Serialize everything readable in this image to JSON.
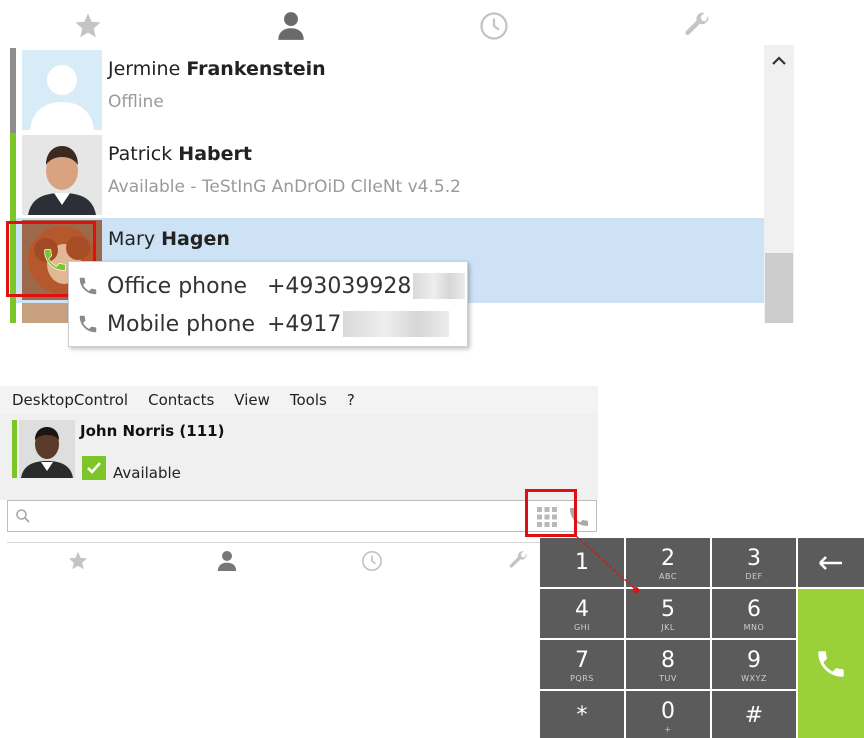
{
  "top_tabs": [
    {
      "icon": "star-icon"
    },
    {
      "icon": "person-icon"
    },
    {
      "icon": "clock-icon"
    },
    {
      "icon": "wrench-icon"
    }
  ],
  "contacts": [
    {
      "first": "Jermine",
      "last": "Frankenstein",
      "status": "Offline"
    },
    {
      "first": "Patrick",
      "last": "Habert",
      "status": "Available - TeStInG AnDrOiD ClIeNt v4.5.2"
    },
    {
      "first": "Mary",
      "last": "Hagen",
      "status": ""
    }
  ],
  "call_popup": {
    "items": [
      {
        "type": "Office phone",
        "number": "+493039928"
      },
      {
        "type": "Mobile phone",
        "number": "+4917"
      }
    ]
  },
  "menu": [
    "DesktopControl",
    "Contacts",
    "View",
    "Tools",
    "?"
  ],
  "user": {
    "name": "John Norris (111)",
    "status": "Available"
  },
  "search": {
    "placeholder": ""
  },
  "bottom_tabs": [
    {
      "icon": "star-icon"
    },
    {
      "icon": "person-icon"
    },
    {
      "icon": "clock-icon"
    },
    {
      "icon": "wrench-icon"
    }
  ],
  "dialpad": {
    "keys": [
      {
        "digit": "1",
        "letters": ""
      },
      {
        "digit": "2",
        "letters": "ABC"
      },
      {
        "digit": "3",
        "letters": "DEF"
      },
      {
        "digit": "4",
        "letters": "GHI"
      },
      {
        "digit": "5",
        "letters": "JKL"
      },
      {
        "digit": "6",
        "letters": "MNO"
      },
      {
        "digit": "7",
        "letters": "PQRS"
      },
      {
        "digit": "8",
        "letters": "TUV"
      },
      {
        "digit": "9",
        "letters": "WXYZ"
      },
      {
        "digit": "*",
        "letters": ""
      },
      {
        "digit": "0",
        "letters": "+"
      },
      {
        "digit": "#",
        "letters": ""
      }
    ]
  },
  "colors": {
    "available": "#7dc62a",
    "offline": "#8d8d8d",
    "selected_row": "#cde3f5",
    "highlight": "#e01010",
    "key": "#5b5b5b",
    "call": "#9ad13b"
  }
}
